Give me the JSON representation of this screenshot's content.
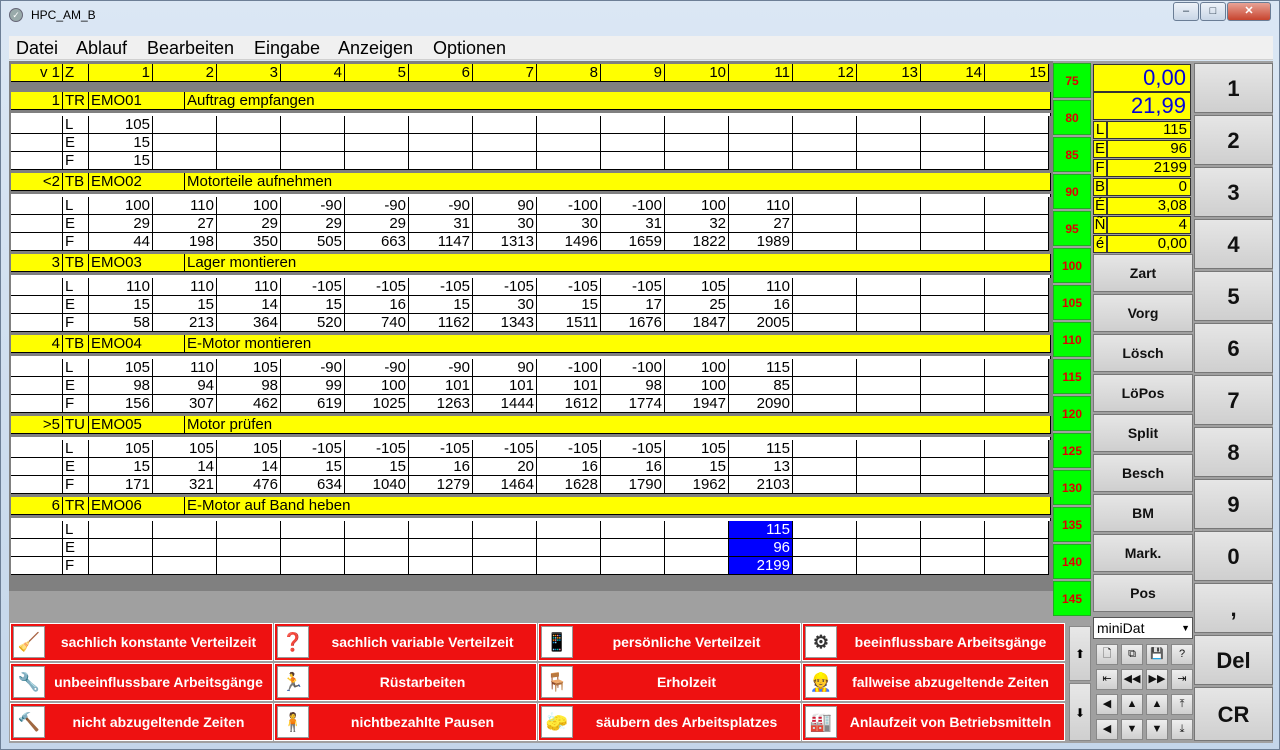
{
  "window": {
    "title": "HPC_AM_B",
    "btn_min": "–",
    "btn_max": "□",
    "btn_close": "✕"
  },
  "menu": [
    "Datei",
    "Ablauf",
    "Bearbeiten",
    "Eingabe",
    "Anzeigen",
    "Optionen"
  ],
  "header": {
    "c0": "v 1",
    "c1": "Z",
    "cols": [
      "1",
      "2",
      "3",
      "4",
      "5",
      "6",
      "7",
      "8",
      "9",
      "10",
      "11",
      "12",
      "13",
      "14",
      "15"
    ]
  },
  "blocks": [
    {
      "num": "1",
      "type": "TR",
      "code": "EMO01",
      "desc": "Auftrag empfangen",
      "L": [
        "105",
        "",
        "",
        "",
        "",
        "",
        "",
        "",
        "",
        "",
        "",
        "",
        "",
        "",
        ""
      ],
      "E": [
        "15",
        "",
        "",
        "",
        "",
        "",
        "",
        "",
        "",
        "",
        "",
        "",
        "",
        "",
        ""
      ],
      "F": [
        "15",
        "",
        "",
        "",
        "",
        "",
        "",
        "",
        "",
        "",
        "",
        "",
        "",
        "",
        ""
      ]
    },
    {
      "num": "<2",
      "type": "TB",
      "code": "EMO02",
      "desc": "Motorteile aufnehmen",
      "L": [
        "100",
        "110",
        "100",
        "-90",
        "-90",
        "-90",
        "90",
        "-100",
        "-100",
        "100",
        "110",
        "",
        "",
        "",
        ""
      ],
      "E": [
        "29",
        "27",
        "29",
        "29",
        "29",
        "31",
        "30",
        "30",
        "31",
        "32",
        "27",
        "",
        "",
        "",
        ""
      ],
      "F": [
        "44",
        "198",
        "350",
        "505",
        "663",
        "1147",
        "1313",
        "1496",
        "1659",
        "1822",
        "1989",
        "",
        "",
        "",
        ""
      ]
    },
    {
      "num": "3",
      "type": "TB",
      "code": "EMO03",
      "desc": "Lager montieren",
      "L": [
        "110",
        "110",
        "110",
        "-105",
        "-105",
        "-105",
        "-105",
        "-105",
        "-105",
        "105",
        "110",
        "",
        "",
        "",
        ""
      ],
      "E": [
        "15",
        "15",
        "14",
        "15",
        "16",
        "15",
        "30",
        "15",
        "17",
        "25",
        "16",
        "",
        "",
        "",
        ""
      ],
      "F": [
        "58",
        "213",
        "364",
        "520",
        "740",
        "1162",
        "1343",
        "1511",
        "1676",
        "1847",
        "2005",
        "",
        "",
        "",
        ""
      ]
    },
    {
      "num": "4",
      "type": "TB",
      "code": "EMO04",
      "desc": "E-Motor montieren",
      "L": [
        "105",
        "110",
        "105",
        "-90",
        "-90",
        "-90",
        "90",
        "-100",
        "-100",
        "100",
        "115",
        "",
        "",
        "",
        ""
      ],
      "E": [
        "98",
        "94",
        "98",
        "99",
        "100",
        "101",
        "101",
        "101",
        "98",
        "100",
        "85",
        "",
        "",
        "",
        ""
      ],
      "F": [
        "156",
        "307",
        "462",
        "619",
        "1025",
        "1263",
        "1444",
        "1612",
        "1774",
        "1947",
        "2090",
        "",
        "",
        "",
        ""
      ]
    },
    {
      "num": ">5",
      "type": "TU",
      "code": "EMO05",
      "desc": "Motor prüfen",
      "L": [
        "105",
        "105",
        "105",
        "-105",
        "-105",
        "-105",
        "-105",
        "-105",
        "-105",
        "105",
        "115",
        "",
        "",
        "",
        ""
      ],
      "E": [
        "15",
        "14",
        "14",
        "15",
        "15",
        "16",
        "20",
        "16",
        "16",
        "15",
        "13",
        "",
        "",
        "",
        ""
      ],
      "F": [
        "171",
        "321",
        "476",
        "634",
        "1040",
        "1279",
        "1464",
        "1628",
        "1790",
        "1962",
        "2103",
        "",
        "",
        "",
        ""
      ]
    },
    {
      "num": "6",
      "type": "TR",
      "code": "EMO06",
      "desc": "E-Motor auf Band heben",
      "L": [
        "",
        "",
        "",
        "",
        "",
        "",
        "",
        "",
        "",
        "",
        "115",
        "",
        "",
        "",
        ""
      ],
      "E": [
        "",
        "",
        "",
        "",
        "",
        "",
        "",
        "",
        "",
        "",
        "96",
        "",
        "",
        "",
        ""
      ],
      "F": [
        "",
        "",
        "",
        "",
        "",
        "",
        "",
        "",
        "",
        "",
        "2199",
        "",
        "",
        "",
        ""
      ]
    }
  ],
  "row_labels": [
    "L",
    "E",
    "F"
  ],
  "green_scale": [
    "75",
    "80",
    "85",
    "90",
    "95",
    "100",
    "105",
    "110",
    "115",
    "120",
    "125",
    "130",
    "135",
    "140",
    "145"
  ],
  "display": {
    "top": "0,00",
    "second": "21,99"
  },
  "registers": [
    {
      "label": "L",
      "value": "115"
    },
    {
      "label": "E",
      "value": "96"
    },
    {
      "label": "F",
      "value": "2199"
    },
    {
      "label": "B",
      "value": "0"
    },
    {
      "label": "É",
      "value": "3,08"
    },
    {
      "label": "Ñ",
      "value": "4"
    },
    {
      "label": "é",
      "value": "0,00"
    }
  ],
  "func_buttons": [
    "Zart",
    "Vorg",
    "Lösch",
    "LöPos",
    "Split",
    "Besch",
    "BM",
    "Mark.",
    "Pos"
  ],
  "keypad": [
    "1",
    "2",
    "3",
    "4",
    "5",
    "6",
    "7",
    "8",
    "9",
    "0",
    ",",
    "Del",
    "CR"
  ],
  "combo": {
    "value": "miniDat"
  },
  "toolbar_icons": [
    "new-icon",
    "copy-icon",
    "save-icon",
    "help-icon",
    "first-icon",
    "prev-fast-icon",
    "next-fast-icon",
    "last-icon",
    "left-icon",
    "up-icon",
    "down-icon",
    "top-icon",
    "left2-icon",
    "down2-icon",
    "down3-icon",
    "bottom-icon"
  ],
  "toolbar_glyphs": [
    "🗋",
    "⧉",
    "💾",
    "?",
    "⇤",
    "◀◀",
    "▶▶",
    "⇥",
    "◀",
    "▲",
    "▲",
    "⤒",
    "◀",
    "▼",
    "▼",
    "⤓"
  ],
  "scroll": {
    "up": "⬆",
    "down": "⬇"
  },
  "red_buttons": [
    {
      "label": "sachlich konstante Verteilzeit",
      "icon": "🧹"
    },
    {
      "label": "sachlich variable Verteilzeit",
      "icon": "❓"
    },
    {
      "label": "persönliche Verteilzeit",
      "icon": "📱"
    },
    {
      "label": "beeinflussbare Arbeitsgänge",
      "icon": "⚙"
    },
    {
      "label": "unbeeinflussbare Arbeitsgänge",
      "icon": "🔧"
    },
    {
      "label": "Rüstarbeiten",
      "icon": "🏃"
    },
    {
      "label": "Erholzeit",
      "icon": "🪑"
    },
    {
      "label": "fallweise abzugeltende Zeiten",
      "icon": "👷"
    },
    {
      "label": "nicht abzugeltende Zeiten",
      "icon": "🔨"
    },
    {
      "label": "nichtbezahlte Pausen",
      "icon": "🧍"
    },
    {
      "label": "säubern des Arbeitsplatzes",
      "icon": "🧽"
    },
    {
      "label": "Anlaufzeit von Betriebsmitteln",
      "icon": "🏭"
    }
  ]
}
